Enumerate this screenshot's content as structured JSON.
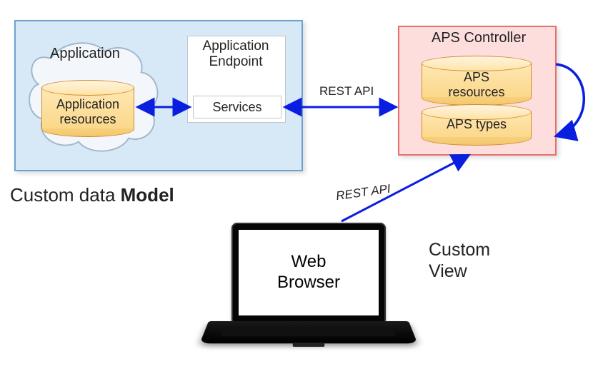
{
  "model": {
    "caption_prefix": "Custom data ",
    "caption_bold": "Model",
    "cloud_label": "Application",
    "resources_label": "Application\nresources",
    "endpoint_title": "Application\nEndpoint",
    "services_label": "Services"
  },
  "aps": {
    "title": "APS Controller",
    "resources_label": "APS\nresources",
    "types_label": "APS types"
  },
  "connections": {
    "rest_api_1": "REST API",
    "rest_api_2": "REST API"
  },
  "client": {
    "screen_label": "Web\nBrowser",
    "view_label": "Custom\nView"
  },
  "colors": {
    "model_bg": "#d7e8f7",
    "model_border": "#6fa2d0",
    "aps_bg": "#fddedd",
    "aps_border": "#e6706f",
    "arrow": "#0a1ee0",
    "cylinder_fill": "#fbd88a",
    "cylinder_stroke": "#d08b2a"
  }
}
